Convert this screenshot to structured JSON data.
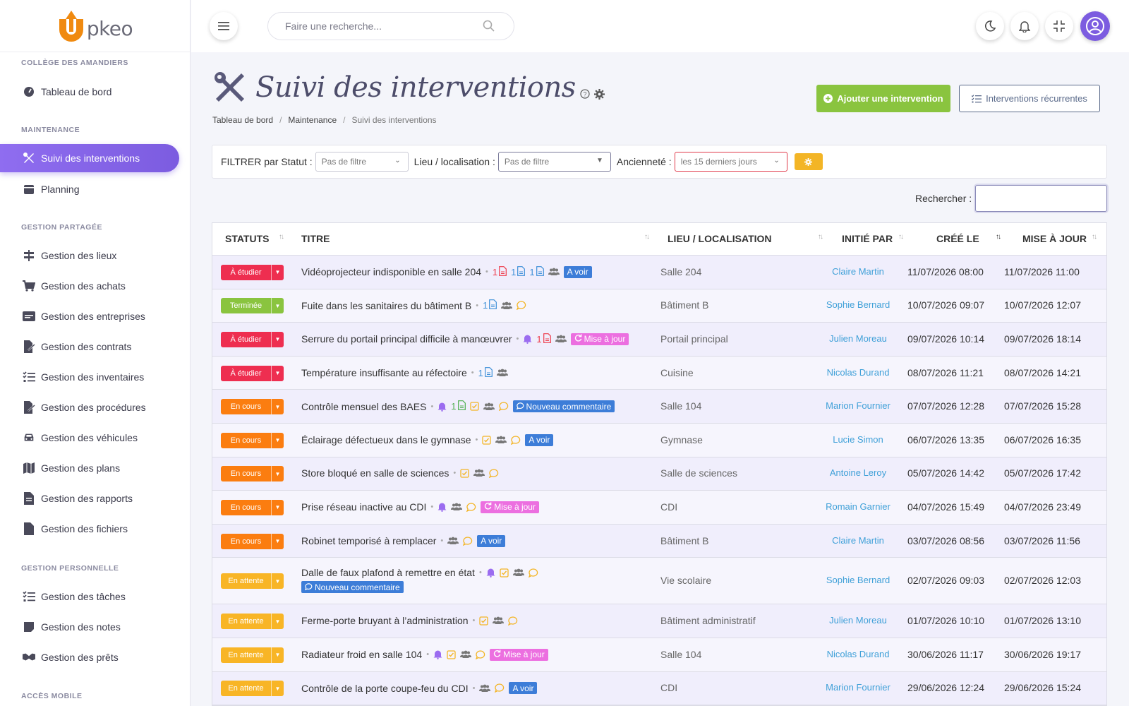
{
  "app": {
    "logo_text": "pkeo"
  },
  "colors": {
    "accent": "#7c5ce0",
    "green": "#8ac43f",
    "red": "#ee2e50",
    "orange": "#fb7d10",
    "amber": "#f8b526",
    "lime": "#8ac43f",
    "link": "#3fa0d8"
  },
  "topbar": {
    "search_placeholder": "Faire une recherche..."
  },
  "sidebar": {
    "sections": [
      {
        "label": "COLLÈGE DES AMANDIERS"
      },
      {
        "label": "MAINTENANCE"
      },
      {
        "label": "GESTION PARTAGÉE"
      },
      {
        "label": "GESTION PERSONNELLE"
      },
      {
        "label": "ACCÈS MOBILE"
      }
    ],
    "items": [
      {
        "label": "Tableau de bord",
        "icon": "gauge-icon"
      },
      {
        "label": "Suivi des interventions",
        "icon": "tools-icon"
      },
      {
        "label": "Planning",
        "icon": "calendar-icon"
      },
      {
        "label": "Gestion des lieux",
        "icon": "signpost-icon"
      },
      {
        "label": "Gestion des achats",
        "icon": "cart-icon"
      },
      {
        "label": "Gestion des entreprises",
        "icon": "id-card-icon"
      },
      {
        "label": "Gestion des contrats",
        "icon": "file-signature-icon"
      },
      {
        "label": "Gestion des inventaires",
        "icon": "list-check-icon"
      },
      {
        "label": "Gestion des procédures",
        "icon": "file-signature-icon"
      },
      {
        "label": "Gestion des véhicules",
        "icon": "car-icon"
      },
      {
        "label": "Gestion des plans",
        "icon": "map-icon"
      },
      {
        "label": "Gestion des rapports",
        "icon": "file-text-icon"
      },
      {
        "label": "Gestion des fichiers",
        "icon": "file-icon"
      },
      {
        "label": "Gestion des tâches",
        "icon": "list-check-icon"
      },
      {
        "label": "Gestion des notes",
        "icon": "note-icon"
      },
      {
        "label": "Gestion des prêts",
        "icon": "handshake-icon"
      }
    ]
  },
  "page": {
    "title": "Suivi des interventions",
    "breadcrumb": [
      "Tableau de bord",
      "Maintenance",
      "Suivi des interventions"
    ],
    "btn_add": "Ajouter une intervention",
    "btn_recurring": "Interventions récurrentes"
  },
  "filters": {
    "status_label": "FILTRER par Statut :",
    "status_value": "Pas de filtre",
    "lieu_label": "Lieu / localisation :",
    "lieu_value": "Pas de filtre",
    "anc_label": "Ancienneté :",
    "anc_value": "les 15 derniers jours",
    "search_label": "Rechercher :"
  },
  "table": {
    "headers": [
      "STATUTS",
      "TITRE",
      "LIEU / LOCALISATION",
      "INITIÉ PAR",
      "CRÉÉ LE",
      "MISE À JOUR"
    ],
    "rows": [
      {
        "status": "À étudier",
        "color": "#ee2e50",
        "title": "Vidéoprojecteur indisponible en salle 204",
        "meta": [
          "pdf:1",
          "doc:1",
          "doc:1",
          "group",
          "badge-blue:A voir"
        ],
        "lieu": "Salle 204",
        "init": "Claire Martin",
        "cree": "11/07/2026 08:00",
        "maj": "11/07/2026 11:00"
      },
      {
        "status": "Terminée",
        "color": "#8ac43f",
        "title": "Fuite dans les sanitaires du bâtiment B",
        "meta": [
          "doc:1",
          "group",
          "comment"
        ],
        "lieu": "Bâtiment B",
        "init": "Sophie Bernard",
        "cree": "10/07/2026 09:07",
        "maj": "10/07/2026 12:07"
      },
      {
        "status": "À étudier",
        "color": "#ee2e50",
        "title": "Serrure du portail principal difficile à manœuvrer",
        "meta": [
          "bell",
          "pdf:1",
          "group",
          "badge-pink:Mise à jour"
        ],
        "lieu": "Portail principal",
        "init": "Julien Moreau",
        "cree": "09/07/2026 10:14",
        "maj": "09/07/2026 18:14"
      },
      {
        "status": "À étudier",
        "color": "#ee2e50",
        "title": "Température insuffisante au réfectoire",
        "meta": [
          "doc:1",
          "group"
        ],
        "lieu": "Cuisine",
        "init": "Nicolas Durand",
        "cree": "08/07/2026 11:21",
        "maj": "08/07/2026 14:21"
      },
      {
        "status": "En cours",
        "color": "#fb7d10",
        "title": "Contrôle mensuel des BAES",
        "meta": [
          "bell",
          "xls:1",
          "check",
          "group",
          "comment",
          "badge-blue-c:Nouveau commentaire"
        ],
        "lieu": "Salle 104",
        "init": "Marion Fournier",
        "cree": "07/07/2026 12:28",
        "maj": "07/07/2026 15:28"
      },
      {
        "status": "En cours",
        "color": "#fb7d10",
        "title": "Éclairage défectueux dans le gymnase",
        "meta": [
          "check",
          "group",
          "comment",
          "badge-blue:A voir"
        ],
        "lieu": "Gymnase",
        "init": "Lucie Simon",
        "cree": "06/07/2026 13:35",
        "maj": "06/07/2026 16:35"
      },
      {
        "status": "En cours",
        "color": "#fb7d10",
        "title": "Store bloqué en salle de sciences",
        "meta": [
          "check",
          "group",
          "comment"
        ],
        "lieu": "Salle de sciences",
        "init": "Antoine Leroy",
        "cree": "05/07/2026 14:42",
        "maj": "05/07/2026 17:42"
      },
      {
        "status": "En cours",
        "color": "#fb7d10",
        "title": "Prise réseau inactive au CDI",
        "meta": [
          "bell",
          "group",
          "comment",
          "badge-pink:Mise à jour"
        ],
        "lieu": "CDI",
        "init": "Romain Garnier",
        "cree": "04/07/2026 15:49",
        "maj": "04/07/2026 23:49"
      },
      {
        "status": "En cours",
        "color": "#fb7d10",
        "title": "Robinet temporisé à remplacer",
        "meta": [
          "group",
          "comment",
          "badge-blue:A voir"
        ],
        "lieu": "Bâtiment B",
        "init": "Claire Martin",
        "cree": "03/07/2026 08:56",
        "maj": "03/07/2026 11:56"
      },
      {
        "status": "En attente",
        "color": "#f8b526",
        "title": "Dalle de faux plafond à remettre en état",
        "meta": [
          "bell",
          "check",
          "group",
          "comment",
          "wrap",
          "badge-blue-c:Nouveau commentaire"
        ],
        "lieu": "Vie scolaire",
        "init": "Sophie Bernard",
        "cree": "02/07/2026 09:03",
        "maj": "02/07/2026 12:03"
      },
      {
        "status": "En attente",
        "color": "#f8b526",
        "title": "Ferme-porte bruyant à l’administration",
        "meta": [
          "check",
          "group",
          "comment"
        ],
        "lieu": "Bâtiment administratif",
        "init": "Julien Moreau",
        "cree": "01/07/2026 10:10",
        "maj": "01/07/2026 13:10"
      },
      {
        "status": "En attente",
        "color": "#f8b526",
        "title": "Radiateur froid en salle 104",
        "meta": [
          "bell",
          "check",
          "group",
          "comment",
          "badge-pink:Mise à jour"
        ],
        "lieu": "Salle 104",
        "init": "Nicolas Durand",
        "cree": "30/06/2026 11:17",
        "maj": "30/06/2026 19:17"
      },
      {
        "status": "En attente",
        "color": "#f8b526",
        "title": "Contrôle de la porte coupe-feu du CDI",
        "meta": [
          "group",
          "comment",
          "badge-blue:A voir"
        ],
        "lieu": "CDI",
        "init": "Marion Fournier",
        "cree": "29/06/2026 12:24",
        "maj": "29/06/2026 15:24"
      }
    ]
  }
}
